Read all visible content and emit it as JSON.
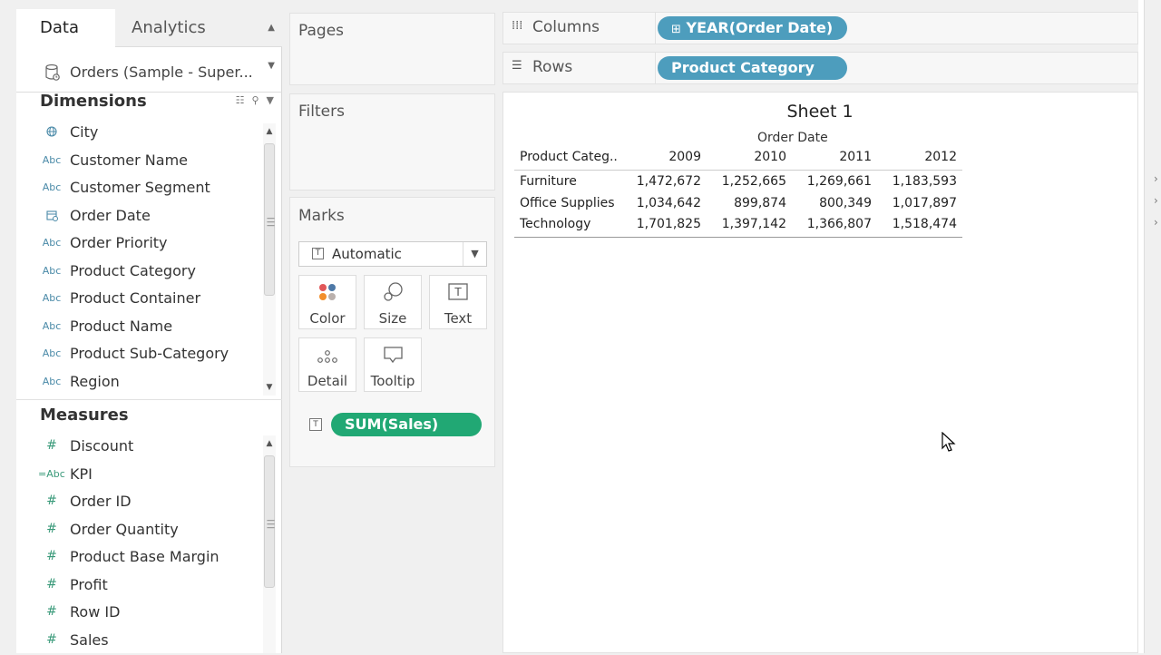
{
  "data_pane": {
    "tabs": [
      {
        "label": "Data",
        "active": true
      },
      {
        "label": "Analytics",
        "active": false
      }
    ],
    "datasource": "Orders (Sample - Super...",
    "dimensions_title": "Dimensions",
    "dimensions": [
      {
        "label": "City",
        "type": "globe-icon"
      },
      {
        "label": "Customer Name",
        "type": "Abc"
      },
      {
        "label": "Customer Segment",
        "type": "Abc"
      },
      {
        "label": "Order Date",
        "type": "calendar-icon"
      },
      {
        "label": "Order Priority",
        "type": "Abc"
      },
      {
        "label": "Product Category",
        "type": "Abc"
      },
      {
        "label": "Product Container",
        "type": "Abc"
      },
      {
        "label": "Product Name",
        "type": "Abc"
      },
      {
        "label": "Product Sub-Category",
        "type": "Abc"
      },
      {
        "label": "Region",
        "type": "Abc"
      }
    ],
    "measures_title": "Measures",
    "measures": [
      {
        "label": "Discount",
        "type": "#"
      },
      {
        "label": "KPI",
        "type": "=Abc"
      },
      {
        "label": "Order ID",
        "type": "#"
      },
      {
        "label": "Order Quantity",
        "type": "#"
      },
      {
        "label": "Product Base Margin",
        "type": "#"
      },
      {
        "label": "Profit",
        "type": "#"
      },
      {
        "label": "Row ID",
        "type": "#"
      },
      {
        "label": "Sales",
        "type": "#"
      }
    ]
  },
  "cards": {
    "pages": "Pages",
    "filters": "Filters",
    "marks": "Marks"
  },
  "marks": {
    "mark_type": "Automatic",
    "buttons": [
      "Color",
      "Size",
      "Text",
      "Detail",
      "Tooltip"
    ],
    "pill": "SUM(Sales)"
  },
  "shelves": {
    "columns_label": "Columns",
    "columns_pill": "YEAR(Order Date)",
    "rows_label": "Rows",
    "rows_pill": "Product Category"
  },
  "sheet": {
    "title": "Sheet 1",
    "column_header": "Order Date",
    "row_header": "Product Categ..",
    "years": [
      "2009",
      "2010",
      "2011",
      "2012"
    ],
    "rows": [
      {
        "label": "Furniture",
        "values": [
          "1,472,672",
          "1,252,665",
          "1,269,661",
          "1,183,593"
        ]
      },
      {
        "label": "Office Supplies",
        "values": [
          "1,034,642",
          "899,874",
          "800,349",
          "1,017,897"
        ]
      },
      {
        "label": "Technology",
        "values": [
          "1,701,825",
          "1,397,142",
          "1,366,807",
          "1,518,474"
        ]
      }
    ]
  },
  "colors": {
    "dimension_pill": "#4d9dbd",
    "measure_pill": "#21a874"
  }
}
